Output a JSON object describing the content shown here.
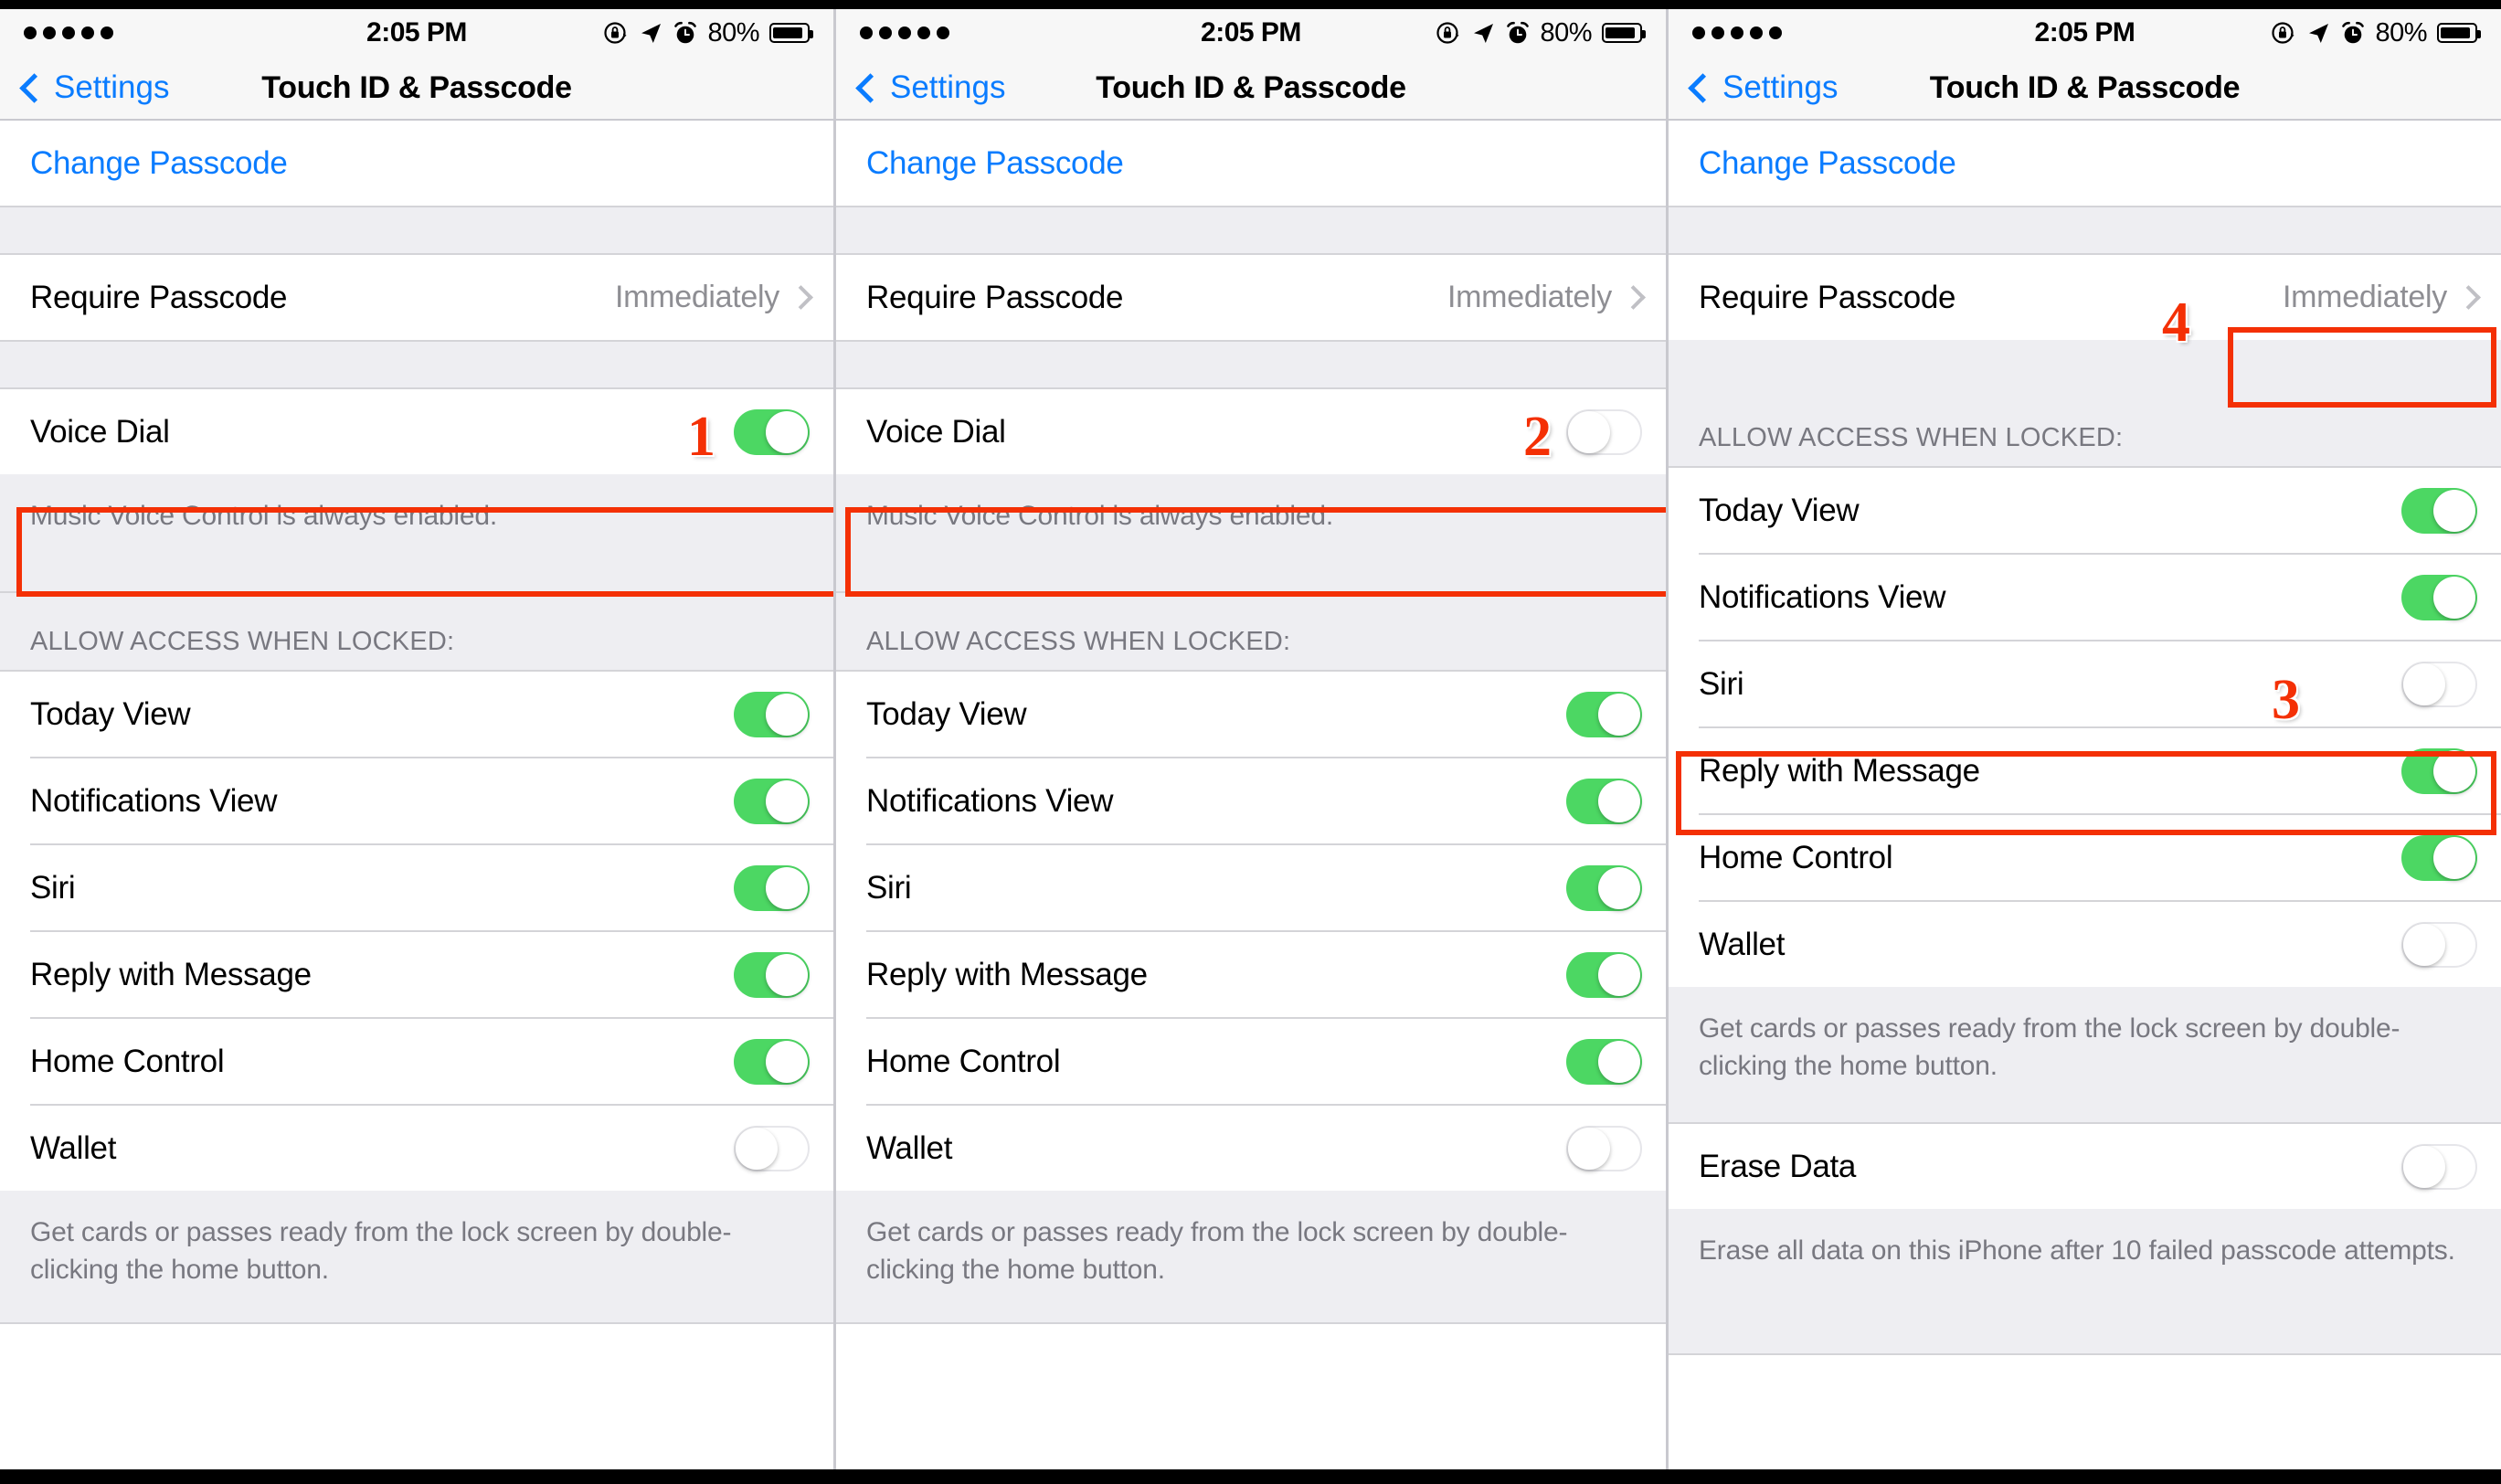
{
  "status_bar": {
    "signal_dots": 5,
    "time": "2:05 PM",
    "battery_percent": "80%",
    "icons": [
      "rotation-lock-icon",
      "location-arrow-icon",
      "alarm-clock-icon",
      "battery-icon"
    ]
  },
  "nav": {
    "back_label": "Settings",
    "title": "Touch ID & Passcode"
  },
  "labels": {
    "change_passcode": "Change Passcode",
    "require_passcode": "Require Passcode",
    "require_passcode_value": "Immediately",
    "voice_dial": "Voice Dial",
    "voice_note": "Music Voice Control is always enabled.",
    "allow_access_header": "ALLOW ACCESS WHEN LOCKED:",
    "today_view": "Today View",
    "notifications_view": "Notifications View",
    "siri": "Siri",
    "reply_with_message": "Reply with Message",
    "home_control": "Home Control",
    "wallet": "Wallet",
    "wallet_note": "Get cards or passes ready from the lock screen by double-clicking the home button.",
    "erase_data": "Erase Data",
    "erase_note": "Erase all data on this iPhone after 10 failed passcode attempts."
  },
  "panels": [
    {
      "id": "panel-1",
      "voice_dial_state": "on",
      "rows": [
        {
          "label": "Today View",
          "state": "on"
        },
        {
          "label": "Notifications View",
          "state": "on"
        },
        {
          "label": "Siri",
          "state": "on"
        },
        {
          "label": "Reply with Message",
          "state": "on"
        },
        {
          "label": "Home Control",
          "state": "on"
        },
        {
          "label": "Wallet",
          "state": "off"
        }
      ]
    },
    {
      "id": "panel-2",
      "voice_dial_state": "off",
      "rows": [
        {
          "label": "Today View",
          "state": "on"
        },
        {
          "label": "Notifications View",
          "state": "on"
        },
        {
          "label": "Siri",
          "state": "on"
        },
        {
          "label": "Reply with Message",
          "state": "on"
        },
        {
          "label": "Home Control",
          "state": "on"
        },
        {
          "label": "Wallet",
          "state": "off"
        }
      ]
    },
    {
      "id": "panel-3",
      "rows": [
        {
          "label": "Today View",
          "state": "on"
        },
        {
          "label": "Notifications View",
          "state": "on"
        },
        {
          "label": "Siri",
          "state": "off"
        },
        {
          "label": "Reply with Message",
          "state": "on"
        },
        {
          "label": "Home Control",
          "state": "on"
        },
        {
          "label": "Wallet",
          "state": "off"
        },
        {
          "label": "Erase Data",
          "state": "off"
        }
      ]
    }
  ],
  "annotations": [
    {
      "number": "1",
      "target": "panel-1 Voice Dial row"
    },
    {
      "number": "2",
      "target": "panel-2 Voice Dial row"
    },
    {
      "number": "3",
      "target": "panel-3 Siri row"
    },
    {
      "number": "4",
      "target": "panel-3 Require Passcode value"
    }
  ],
  "colors": {
    "accent_blue": "#0a7cff",
    "toggle_on_green": "#4cd763",
    "annotation_red": "#f43005",
    "group_background": "#eeeef2",
    "secondary_text": "#8e8e93"
  }
}
